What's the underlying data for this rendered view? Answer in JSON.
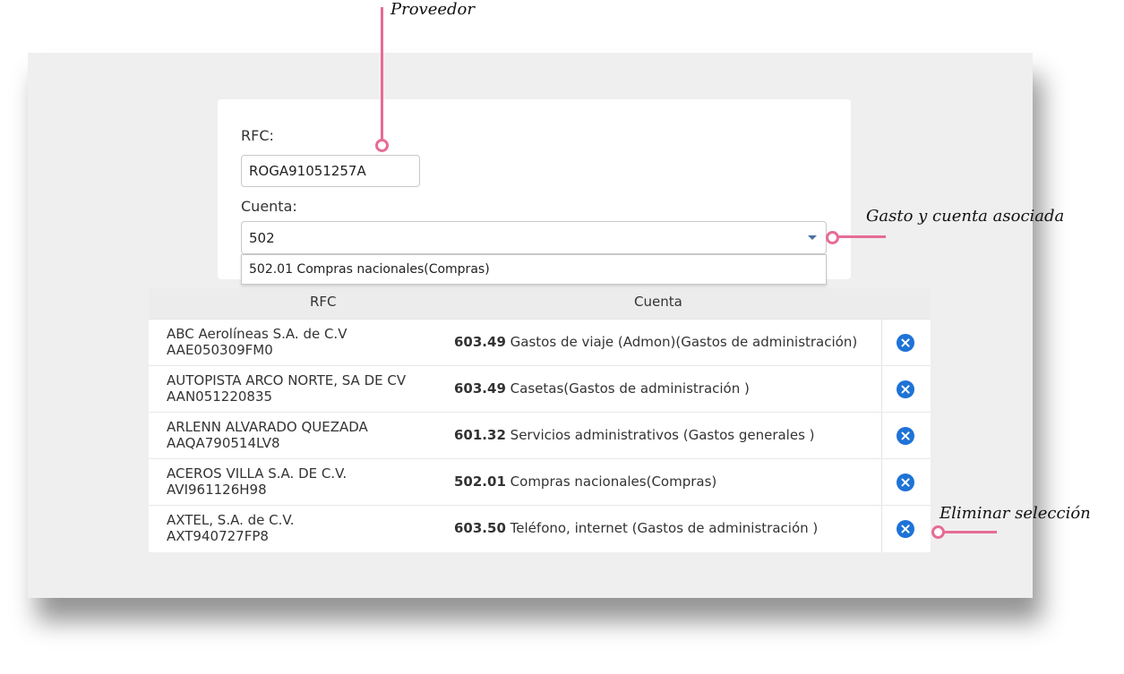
{
  "form": {
    "rfc_label": "RFC:",
    "rfc_value": "ROGA91051257A",
    "cuenta_label": "Cuenta:",
    "cuenta_value": "502",
    "dropdown_option": "502.01 Compras nacionales(Compras)"
  },
  "table": {
    "headers": {
      "rfc": "RFC",
      "cuenta": "Cuenta"
    },
    "rows": [
      {
        "name": "ABC Aerolíneas S.A. de C.V",
        "rfc": "AAE050309FM0",
        "code": "603.49",
        "account": "Gastos de viaje (Admon)(Gastos de administración)"
      },
      {
        "name": "AUTOPISTA ARCO NORTE, SA DE CV",
        "rfc": "AAN051220835",
        "code": "603.49",
        "account": "Casetas(Gastos de administración )"
      },
      {
        "name": "ARLENN ALVARADO QUEZADA",
        "rfc": "AAQA790514LV8",
        "code": "601.32",
        "account": "Servicios administrativos (Gastos generales )"
      },
      {
        "name": "ACEROS VILLA S.A. DE C.V.",
        "rfc": "AVI961126H98",
        "code": "502.01",
        "account": "Compras nacionales(Compras)"
      },
      {
        "name": "AXTEL, S.A. de C.V.",
        "rfc": "AXT940727FP8",
        "code": "603.50",
        "account": "Teléfono, internet (Gastos de administración )"
      }
    ],
    "remove_icon": "remove-circle-icon",
    "remove_icon_color": "#1e73d6"
  },
  "annotations": {
    "proveedor": "Proveedor",
    "gasto": "Gasto y cuenta asociada",
    "eliminar": "Eliminar selección",
    "color": "#e66c97"
  }
}
